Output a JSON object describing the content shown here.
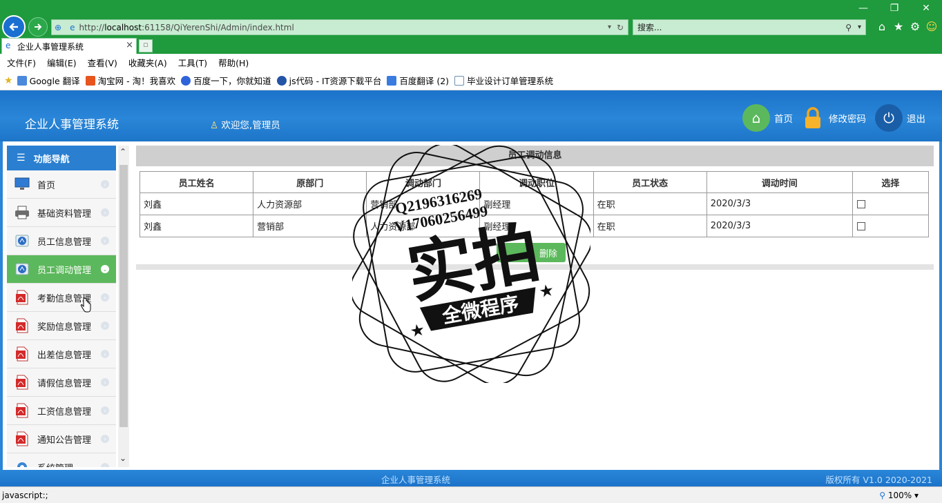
{
  "browser": {
    "url_prefix": "http://",
    "url_host": "localhost",
    "url_rest": ":61158/QiYerenShi/Admin/index.html",
    "search_placeholder": "搜索...",
    "tab_title": "企业人事管理系统",
    "menu": [
      "文件(F)",
      "编辑(E)",
      "查看(V)",
      "收藏夹(A)",
      "工具(T)",
      "帮助(H)"
    ],
    "favorites": [
      {
        "label": "Google 翻译",
        "color": "#4a89dc"
      },
      {
        "label": "淘宝网 - 淘！我喜欢",
        "color": "#e8541e"
      },
      {
        "label": "百度一下，你就知道",
        "color": "#2f63d9"
      },
      {
        "label": "js代码 - IT资源下载平台",
        "color": "#2454a6"
      },
      {
        "label": "百度翻译 (2)",
        "color": "#3a7be0"
      },
      {
        "label": "毕业设计订单管理系统",
        "color": "#6a8fb0"
      }
    ],
    "status": "javascript:;",
    "zoom": "100%"
  },
  "header": {
    "title": "企业人事管理系统",
    "welcome": "欢迎您,管理员",
    "home": "首页",
    "change_password": "修改密码",
    "logout": "退出"
  },
  "sidebar": {
    "heading": "功能导航",
    "items": [
      {
        "label": "首页",
        "icon": "monitor-icon"
      },
      {
        "label": "基础资料管理",
        "icon": "printer-icon"
      },
      {
        "label": "员工信息管理",
        "icon": "globe-icon"
      },
      {
        "label": "员工调动管理",
        "icon": "globe-icon",
        "active": true
      },
      {
        "label": "考勤信息管理",
        "icon": "pdf-icon"
      },
      {
        "label": "奖励信息管理",
        "icon": "pdf-icon"
      },
      {
        "label": "出差信息管理",
        "icon": "pdf-icon"
      },
      {
        "label": "请假信息管理",
        "icon": "pdf-icon"
      },
      {
        "label": "工资信息管理",
        "icon": "pdf-icon"
      },
      {
        "label": "通知公告管理",
        "icon": "pdf-icon"
      },
      {
        "label": "系统管理",
        "icon": "gear-icon"
      }
    ]
  },
  "panel": {
    "title": "员工调动信息",
    "columns": [
      "员工姓名",
      "原部门",
      "调动部门",
      "调动职位",
      "员工状态",
      "调动时间",
      "选择"
    ],
    "rows": [
      [
        "刘鑫",
        "人力资源部",
        "营销部",
        "副经理",
        "在职",
        "2020/3/3"
      ],
      [
        "刘鑫",
        "营销部",
        "人力资源部",
        "副经理",
        "在职",
        "2020/3/3"
      ]
    ],
    "delete_button": "删除"
  },
  "watermark": {
    "line1": "Q2196316269",
    "line2": "V17060256499",
    "main": "实拍",
    "banner": "全微程序"
  },
  "footer": {
    "center": "企业人事管理系统",
    "right": "版权所有 V1.0 2020-2021"
  }
}
